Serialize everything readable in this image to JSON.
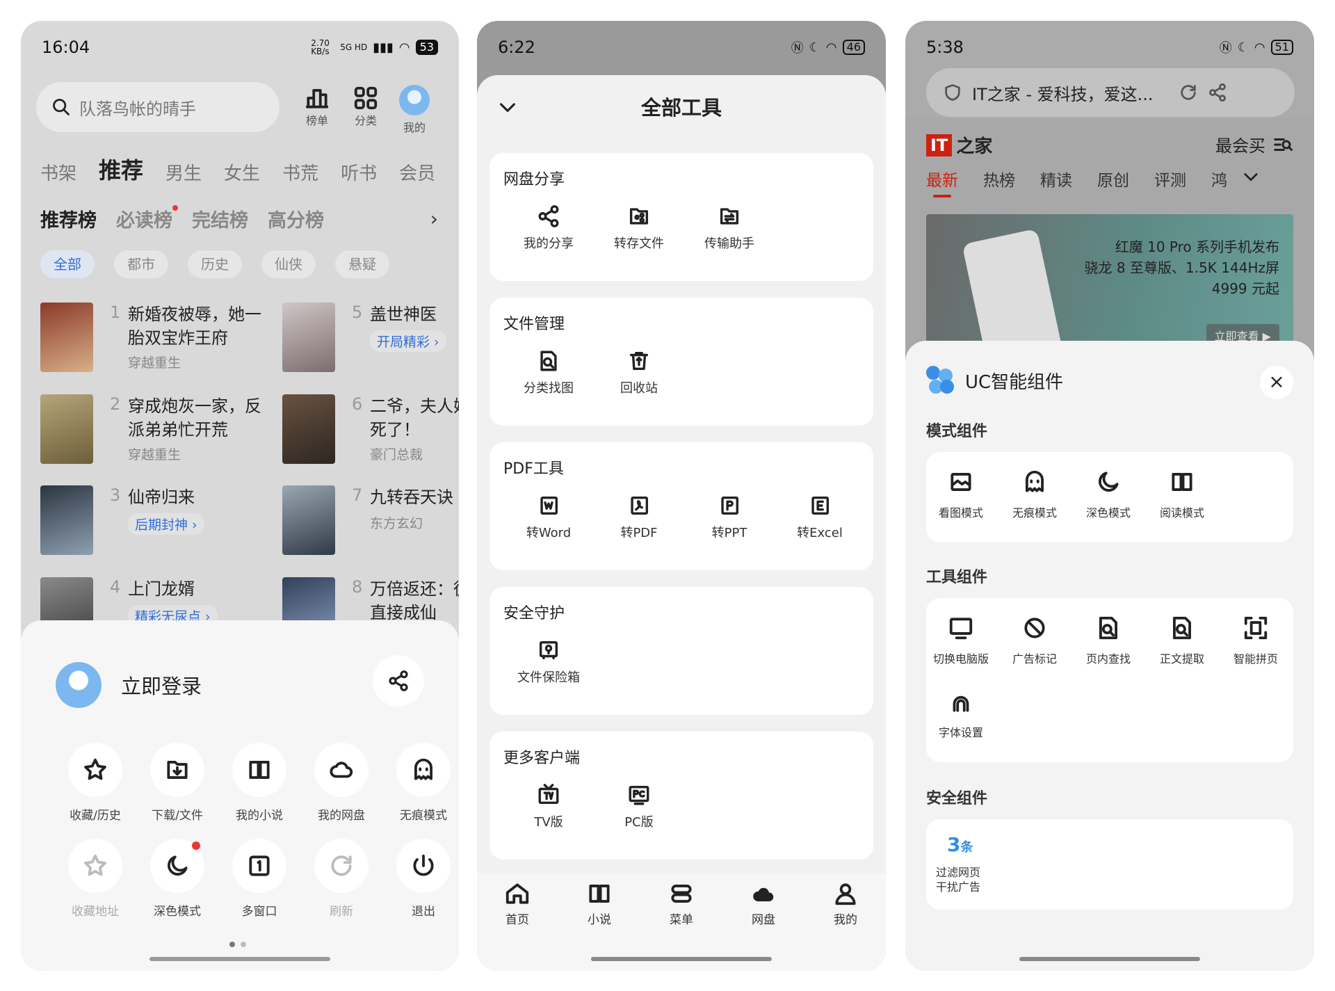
{
  "p1": {
    "time": "16:04",
    "speed": "2.70 KB/s",
    "net": "5G HD",
    "battery": "53",
    "search_placeholder": "队落鸟帐的晴手",
    "top_icons": [
      {
        "label": "榜单",
        "icon": "bar-chart-icon"
      },
      {
        "label": "分类",
        "icon": "grid-icon"
      },
      {
        "label": "我的",
        "icon": "avatar-icon"
      }
    ],
    "tabs": [
      "书架",
      "推荐",
      "男生",
      "女生",
      "书荒",
      "听书",
      "会员"
    ],
    "rank_tabs": [
      "推荐榜",
      "必读榜",
      "完结榜",
      "高分榜"
    ],
    "categories": [
      "全部",
      "都市",
      "历史",
      "仙侠",
      "悬疑"
    ],
    "books": [
      {
        "num": "1",
        "title": "新婚夜被辱，她一胎双宝炸王府",
        "tag": "穿越重生"
      },
      {
        "num": "5",
        "title": "盖世神医",
        "tag": "开局精彩 ›"
      },
      {
        "num": "2",
        "title": "穿成炮灰一家，反派弟弟忙开荒",
        "tag": "穿越重生"
      },
      {
        "num": "6",
        "title": "二爷，夫人她人算死了！",
        "tag": "豪门总裁"
      },
      {
        "num": "3",
        "title": "仙帝归来",
        "tag": "后期封神 ›"
      },
      {
        "num": "7",
        "title": "九转吞天诀",
        "tag": "东方玄幻"
      },
      {
        "num": "4",
        "title": "上门龙婿",
        "tag": "精彩无尿点 ›"
      },
      {
        "num": "8",
        "title": "万倍返还：徒基我直接成仙",
        "tag": ""
      }
    ],
    "login": "立即登录",
    "menu_row1": [
      {
        "label": "收藏/历史",
        "icon": "star-icon"
      },
      {
        "label": "下载/文件",
        "icon": "download-icon"
      },
      {
        "label": "我的小说",
        "icon": "book-icon"
      },
      {
        "label": "我的网盘",
        "icon": "cloud-icon"
      },
      {
        "label": "无痕模式",
        "icon": "ghost-icon"
      }
    ],
    "menu_row2": [
      {
        "label": "收藏地址",
        "icon": "star-plus-icon"
      },
      {
        "label": "深色模式",
        "icon": "moon-icon"
      },
      {
        "label": "多窗口",
        "icon": "window-icon"
      },
      {
        "label": "刷新",
        "icon": "refresh-icon"
      },
      {
        "label": "退出",
        "icon": "power-icon"
      }
    ]
  },
  "p2": {
    "time": "6:22",
    "battery": "46",
    "title": "全部工具",
    "sections": [
      {
        "title": "网盘分享",
        "items": [
          "我的分享",
          "转存文件",
          "传输助手"
        ]
      },
      {
        "title": "文件管理",
        "items": [
          "分类找图",
          "回收站"
        ]
      },
      {
        "title": "PDF工具",
        "items": [
          "转Word",
          "转PDF",
          "转PPT",
          "转Excel"
        ]
      },
      {
        "title": "安全守护",
        "items": [
          "文件保险箱"
        ]
      },
      {
        "title": "更多客户端",
        "items": [
          "TV版",
          "PC版"
        ]
      }
    ],
    "bottom_nav": [
      "首页",
      "小说",
      "菜单",
      "网盘",
      "我的"
    ]
  },
  "p3": {
    "time": "5:38",
    "battery": "51",
    "url": "IT之家 - 爱科技，爱这...",
    "logo_it": "IT",
    "logo_zh": "之家",
    "zmai": "最会买",
    "tabs": [
      "最新",
      "热榜",
      "精读",
      "原创",
      "评测",
      "鸿"
    ],
    "banner_text": [
      "红魔 10 Pro 系列手机发布",
      "骁龙 8 至尊版、1.5K 144Hz屏",
      "4999 元起"
    ],
    "banner_btn": "立即查看 ▶",
    "panel_title": "UC智能组件",
    "mode_title": "模式组件",
    "modes": [
      "看图模式",
      "无痕模式",
      "深色模式",
      "阅读模式"
    ],
    "tool_title": "工具组件",
    "tools": [
      "切换电脑版",
      "广告标记",
      "页内查找",
      "正文提取",
      "智能拼页",
      "字体设置"
    ],
    "sec_title": "安全组件",
    "sec_count": "3",
    "sec_unit": "条",
    "sec_desc1": "过滤网页",
    "sec_desc2": "干扰广告"
  }
}
